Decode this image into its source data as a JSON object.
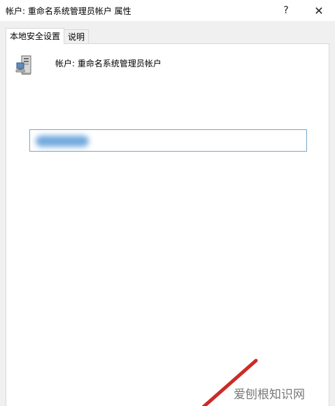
{
  "window": {
    "title": "帐户: 重命名系统管理员帐户 属性",
    "help_label": "?",
    "close_label": "✕"
  },
  "tabs": [
    {
      "label": "本地安全设置",
      "active": true
    },
    {
      "label": "说明",
      "active": false
    }
  ],
  "policy": {
    "icon": "server-computer-icon",
    "label": "帐户: 重命名系统管理员帐户"
  },
  "name_field": {
    "value_redacted": true
  },
  "watermark": {
    "text": "爱刨根知识网"
  },
  "annotation": {
    "arrow_color": "#cc2a28"
  }
}
